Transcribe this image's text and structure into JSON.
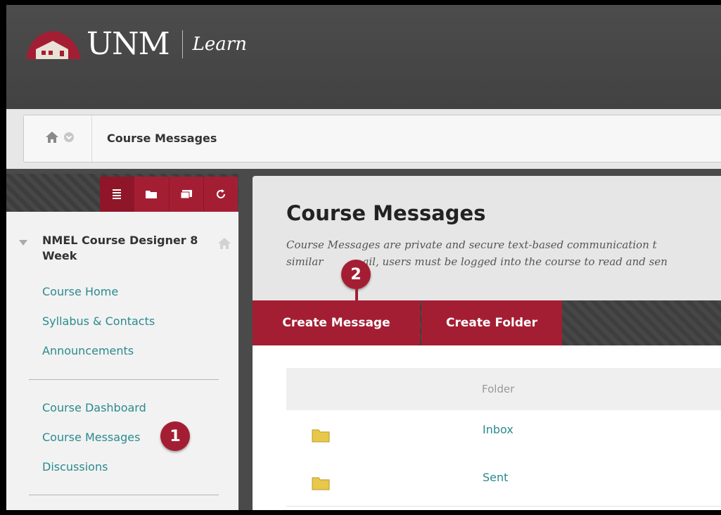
{
  "header": {
    "brand": "UNM",
    "product": "Learn",
    "colors": {
      "brand_red": "#a41e33",
      "topbar": "#484848",
      "link": "#2b8a8e"
    }
  },
  "breadcrumb": {
    "home_icon": "home-icon",
    "menu_icon": "chevron-down-circle-icon",
    "current": "Course Messages"
  },
  "sidebar": {
    "tools": [
      "list-icon",
      "folder-icon",
      "window-icon",
      "refresh-icon"
    ],
    "course_title": "NMEL Course Designer 8 Week",
    "links_group1": [
      "Course Home",
      "Syllabus & Contacts",
      "Announcements"
    ],
    "links_group2": [
      "Course Dashboard",
      "Course Messages",
      "Discussions"
    ]
  },
  "callouts": {
    "one": "1",
    "two": "2"
  },
  "main": {
    "title": "Course Messages",
    "description_line1": "Course Messages are private and secure text-based communication t",
    "description_line2_a": "similar",
    "description_line2_b": "ail, users must be logged into the course to read and sen",
    "actions": {
      "create_message": "Create Message",
      "create_folder": "Create Folder"
    },
    "table": {
      "column_folder": "Folder",
      "rows": [
        {
          "name": "Inbox",
          "edge": "("
        },
        {
          "name": "Sent",
          "edge": "("
        }
      ]
    }
  }
}
